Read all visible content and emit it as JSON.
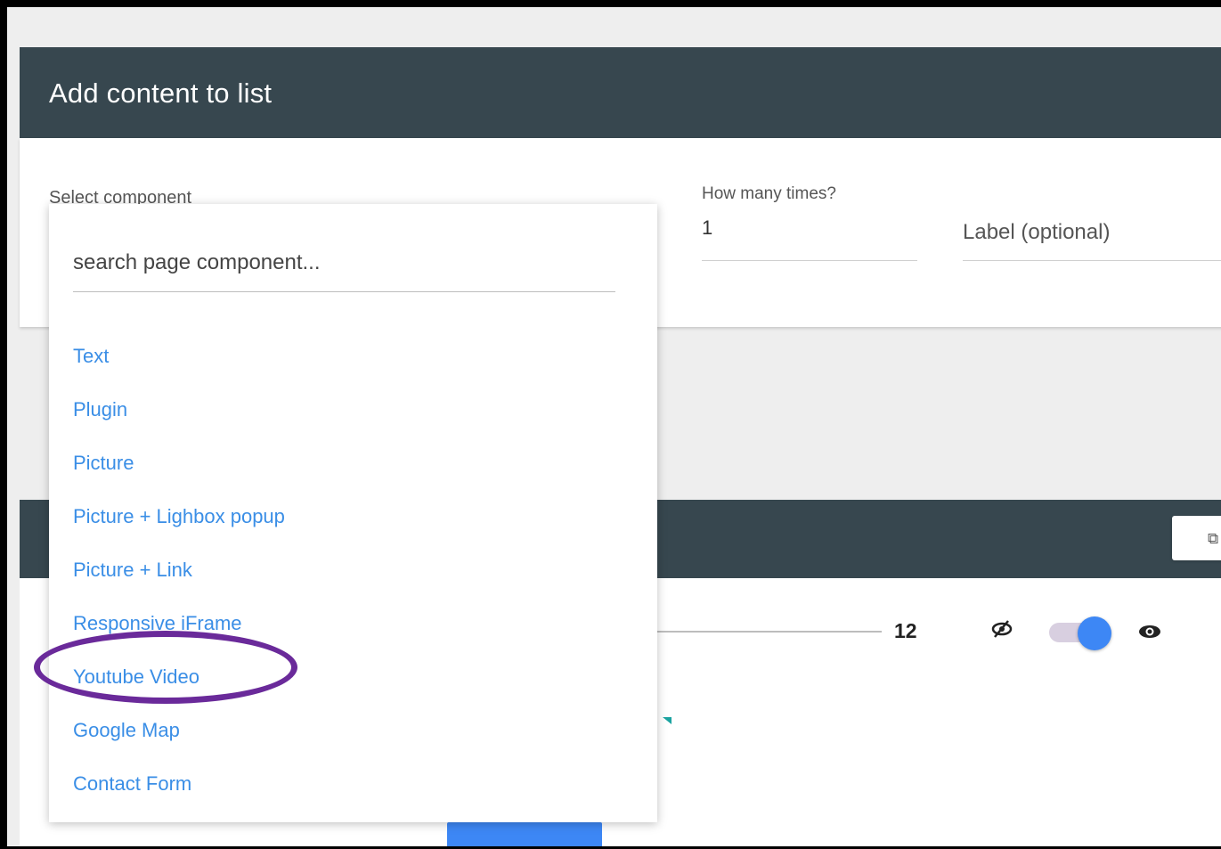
{
  "modal": {
    "title": "Add content to list",
    "select_label": "Select component",
    "times_label": "How many times?",
    "times_value": "1",
    "label_placeholder": "Label (optional)"
  },
  "dropdown": {
    "search_placeholder": "search page component...",
    "options": [
      "Text",
      "Plugin",
      "Picture",
      "Picture + Lighbox popup",
      "Picture + Link",
      "Responsive iFrame",
      "Youtube Video",
      "Google Map",
      "Contact Form"
    ],
    "highlighted_option": "Youtube Video"
  },
  "background_card": {
    "slider_value": "12",
    "toggle_on": true
  },
  "colors": {
    "header": "#37474f",
    "link": "#3a8ee6",
    "accent": "#3d87f5",
    "annotation": "#6a2a9a"
  },
  "icons": [
    "copy-icon",
    "visibility-off-icon",
    "visibility-icon"
  ]
}
